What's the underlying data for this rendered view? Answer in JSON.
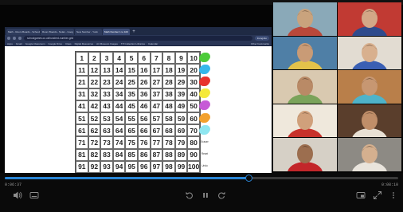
{
  "browser": {
    "tabs": [
      {
        "label": "Math - Room Boards - Schools",
        "active": false
      },
      {
        "label": "Room Boards - Nolan - Goog",
        "active": false
      },
      {
        "label": "New Number - Yunk",
        "active": false
      },
      {
        "label": "Math Number 1 to 100",
        "active": true
      }
    ],
    "new_tab": "+",
    "url": "schoolgames.co.uk/hundred-number-grid",
    "profile": "Incognito",
    "bookmarks": [
      "Apps",
      "Gmail",
      "Google Classroom",
      "Google Drive",
      "Class",
      "Digital Resources",
      "Art Museum Images",
      "TP Collection Libraries",
      "Calendar"
    ],
    "bookmarks_right": "Other bookmarks"
  },
  "hundred_chart": {
    "rows": [
      [
        "1",
        "2",
        "3",
        "4",
        "5",
        "6",
        "7",
        "8",
        "9",
        "10"
      ],
      [
        "11",
        "12",
        "13",
        "14",
        "15",
        "16",
        "17",
        "18",
        "19",
        "20"
      ],
      [
        "21",
        "22",
        "23",
        "24",
        "25",
        "26",
        "27",
        "28",
        "29",
        "30"
      ],
      [
        "31",
        "32",
        "33",
        "34",
        "35",
        "36",
        "37",
        "38",
        "39",
        "40"
      ],
      [
        "41",
        "42",
        "43",
        "44",
        "45",
        "46",
        "47",
        "48",
        "49",
        "50"
      ],
      [
        "51",
        "52",
        "53",
        "54",
        "55",
        "56",
        "57",
        "58",
        "59",
        "60"
      ],
      [
        "61",
        "62",
        "63",
        "64",
        "65",
        "66",
        "67",
        "68",
        "69",
        "70"
      ],
      [
        "71",
        "72",
        "73",
        "74",
        "75",
        "76",
        "77",
        "78",
        "79",
        "80"
      ],
      [
        "81",
        "82",
        "83",
        "84",
        "85",
        "86",
        "87",
        "88",
        "89",
        "90"
      ],
      [
        "91",
        "92",
        "93",
        "94",
        "95",
        "96",
        "97",
        "98",
        "99",
        "100"
      ]
    ]
  },
  "side_controls": [
    {
      "kind": "color",
      "color": "#4ccb3a"
    },
    {
      "kind": "color",
      "color": "#35b7ea"
    },
    {
      "kind": "color",
      "color": "#e8322c"
    },
    {
      "kind": "color",
      "color": "#f5e93a"
    },
    {
      "kind": "color",
      "color": "#c65ad6"
    },
    {
      "kind": "color",
      "color": "#f3a12c"
    },
    {
      "kind": "color",
      "color": "#8fe6f0"
    },
    {
      "kind": "word",
      "label": "Eraser"
    },
    {
      "kind": "word",
      "label": "Reset"
    },
    {
      "kind": "word",
      "label": "Undo"
    }
  ],
  "participants": [
    {
      "tone": "#c9a37d",
      "bg": "#8aa9b8",
      "shirt": "#b9483a"
    },
    {
      "tone": "#d3a887",
      "bg": "#c13a33",
      "shirt": "#2f4b8c"
    },
    {
      "tone": "#c99b76",
      "bg": "#4f7fa6",
      "shirt": "#e3c24a"
    },
    {
      "tone": "#d8b08e",
      "bg": "#e2dcd2",
      "shirt": "#3a5fb3"
    },
    {
      "tone": "#b98a66",
      "bg": "#d9c9b0",
      "shirt": "#7aa35a"
    },
    {
      "tone": "#c79772",
      "bg": "#b97f4a",
      "shirt": "#4fb3c9"
    },
    {
      "tone": "#d0a07b",
      "bg": "#efe8dc",
      "shirt": "#c8322b"
    },
    {
      "tone": "#c08e69",
      "bg": "#5a3e2c",
      "shirt": "#e8e0d4"
    },
    {
      "tone": "#9c6e4f",
      "bg": "#d6d0c6",
      "shirt": "#c3262a"
    },
    {
      "tone": "#d5b08f",
      "bg": "#8d8a84",
      "shirt": "#e9e4dc"
    }
  ],
  "player": {
    "elapsed": "0:06:37",
    "duration": "0:08:10",
    "progress_percent": 62,
    "accent": "#2a86d6"
  }
}
